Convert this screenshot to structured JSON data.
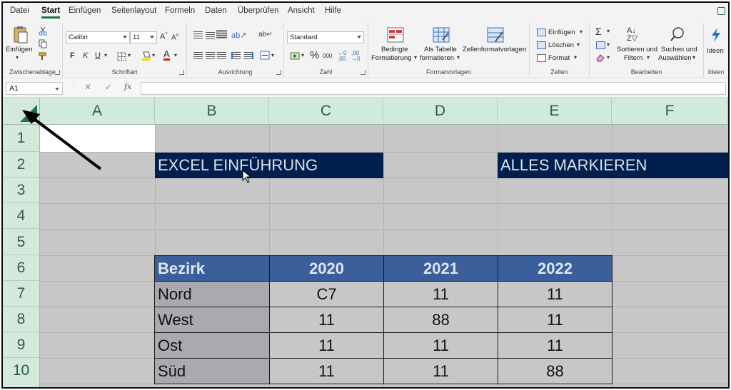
{
  "menu": {
    "tabs": [
      "Datei",
      "Start",
      "Einfügen",
      "Seitenlayout",
      "Formeln",
      "Daten",
      "Überprüfen",
      "Ansicht",
      "Hilfe"
    ],
    "active": "Start"
  },
  "ribbon": {
    "clipboard": {
      "paste_label": "Einfügen",
      "group_label": "Zwischenablage"
    },
    "font": {
      "name": "Calibri",
      "size": "11",
      "bold": "F",
      "italic": "K",
      "underline": "U",
      "group_label": "Schriftart"
    },
    "alignment": {
      "group_label": "Ausrichtung"
    },
    "number": {
      "format": "Standard",
      "group_label": "Zahl"
    },
    "styles": {
      "conditional_line1": "Bedingte",
      "conditional_line2": "Formatierung",
      "table_line1": "Als Tabelle",
      "table_line2": "formatieren",
      "cellstyles_label": "Zellenformatvorlagen",
      "group_label": "Formatvorlagen"
    },
    "cells": {
      "insert": "Einfügen",
      "delete": "Löschen",
      "format": "Format",
      "group_label": "Zellen"
    },
    "editing": {
      "sort_line1": "Sortieren und",
      "sort_line2": "Filtern",
      "find_line1": "Suchen und",
      "find_line2": "Auswählen",
      "group_label": "Bearbeiten"
    },
    "ideas": {
      "label": "Ideen",
      "group_label": "Ideen"
    }
  },
  "formula_bar": {
    "name_box": "A1",
    "fx": "fx",
    "value": ""
  },
  "sheet": {
    "columns": [
      "A",
      "B",
      "C",
      "D",
      "E",
      "F"
    ],
    "rows": [
      "1",
      "2",
      "3",
      "4",
      "5",
      "6",
      "7",
      "8",
      "9",
      "10"
    ],
    "banner_left": "EXCEL EINFÜHRUNG",
    "banner_right": "ALLES MARKIEREN",
    "table": {
      "headers": [
        "Bezirk",
        "2020",
        "2021",
        "2022"
      ],
      "rows": [
        [
          "Nord",
          "C7",
          "11",
          "11"
        ],
        [
          "West",
          "11",
          "88",
          "11"
        ],
        [
          "Ost",
          "11",
          "11",
          "11"
        ],
        [
          "Süd",
          "11",
          "11",
          "88"
        ]
      ]
    }
  },
  "colors": {
    "accent": "#217346",
    "banner": "#001f4d",
    "table_header": "#3a5f9a",
    "selection": "#c7c7c7"
  }
}
